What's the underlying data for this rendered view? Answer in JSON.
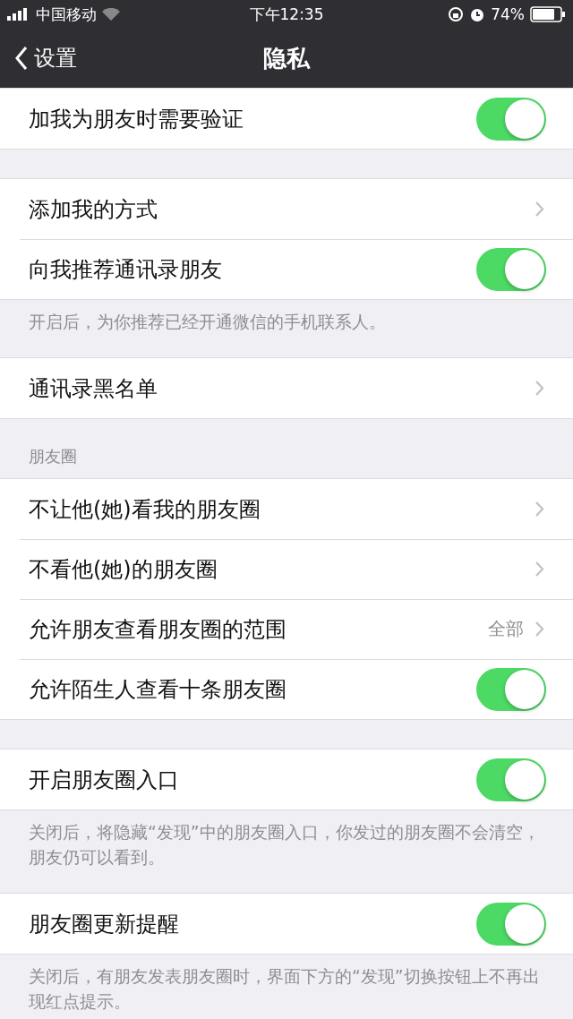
{
  "status_bar": {
    "carrier": "中国移动",
    "time": "下午12:35",
    "battery": "74%"
  },
  "nav": {
    "back": "设置",
    "title": "隐私"
  },
  "sections": [
    {
      "rows": [
        {
          "kind": "toggle",
          "label": "加我为朋友时需要验证",
          "on": true
        }
      ]
    },
    {
      "rows": [
        {
          "kind": "link",
          "label": "添加我的方式"
        },
        {
          "kind": "toggle",
          "label": "向我推荐通讯录朋友",
          "on": true
        }
      ],
      "footer": "开启后，为你推荐已经开通微信的手机联系人。"
    },
    {
      "rows": [
        {
          "kind": "link",
          "label": "通讯录黑名单"
        }
      ]
    },
    {
      "header": "朋友圈",
      "rows": [
        {
          "kind": "link",
          "label": "不让他(她)看我的朋友圈"
        },
        {
          "kind": "link",
          "label": "不看他(她)的朋友圈"
        },
        {
          "kind": "link",
          "label": "允许朋友查看朋友圈的范围",
          "value": "全部"
        },
        {
          "kind": "toggle",
          "label": "允许陌生人查看十条朋友圈",
          "on": true
        }
      ]
    },
    {
      "rows": [
        {
          "kind": "toggle",
          "label": "开启朋友圈入口",
          "on": true
        }
      ],
      "footer": "关闭后，将隐藏“发现”中的朋友圈入口，你发过的朋友圈不会清空，朋友仍可以看到。"
    },
    {
      "rows": [
        {
          "kind": "toggle",
          "label": "朋友圈更新提醒",
          "on": true
        }
      ],
      "footer": "关闭后，有朋友发表朋友圈时，界面下方的“发现”切换按钮上不再出现红点提示。"
    }
  ]
}
